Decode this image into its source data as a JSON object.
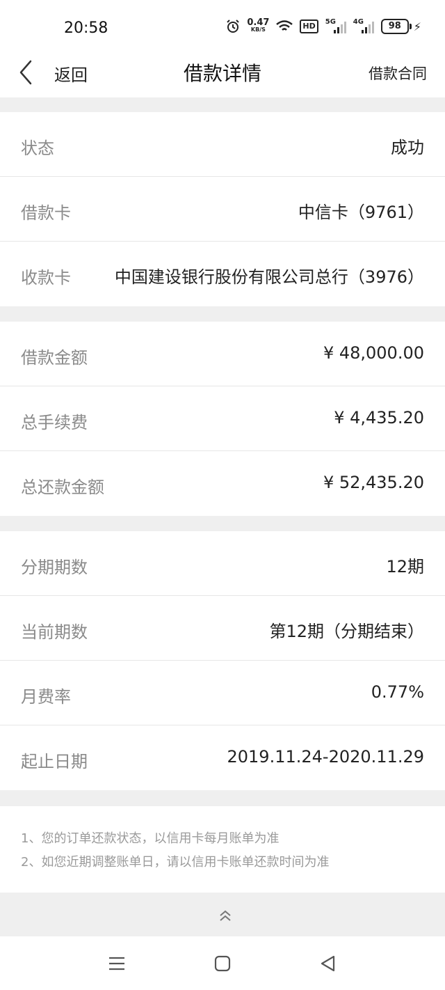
{
  "status_bar": {
    "time": "20:58",
    "net_speed_value": "0.47",
    "net_speed_unit": "KB/S",
    "hd_badge": "HD",
    "signal1_label": "5G",
    "signal2_label": "4G",
    "battery_level": "98",
    "icons": [
      "alarm-icon",
      "wifi-icon",
      "signal-icon",
      "battery-icon",
      "charging-icon"
    ]
  },
  "header": {
    "back_label": "返回",
    "title": "借款详情",
    "contract_link": "借款合同"
  },
  "group_card": {
    "rows": [
      {
        "label": "状态",
        "value": "成功"
      },
      {
        "label": "借款卡",
        "value": "中信卡（9761）"
      },
      {
        "label": "收款卡",
        "value": "中国建设银行股份有限公司总行（3976）"
      }
    ]
  },
  "group_amount": {
    "rows": [
      {
        "label": "借款金额",
        "value": "¥ 48,000.00"
      },
      {
        "label": "总手续费",
        "value": "¥ 4,435.20"
      },
      {
        "label": "总还款金额",
        "value": "¥ 52,435.20"
      }
    ]
  },
  "group_installment": {
    "rows": [
      {
        "label": "分期期数",
        "value": "12期"
      },
      {
        "label": "当前期数",
        "value": "第12期（分期结束）"
      },
      {
        "label": "月费率",
        "value": "0.77%"
      },
      {
        "label": "起止日期",
        "value": "2019.11.24-2020.11.29"
      }
    ]
  },
  "notes": [
    "1、您的订单还款状态，以信用卡每月账单为准",
    "2、如您近期调整账单日，请以信用卡账单还款时间为准"
  ],
  "colors": {
    "background": "#efefef",
    "card": "#ffffff",
    "label_text": "#8a8a8a",
    "value_text": "#222222",
    "note_text": "#9a9a9a"
  }
}
